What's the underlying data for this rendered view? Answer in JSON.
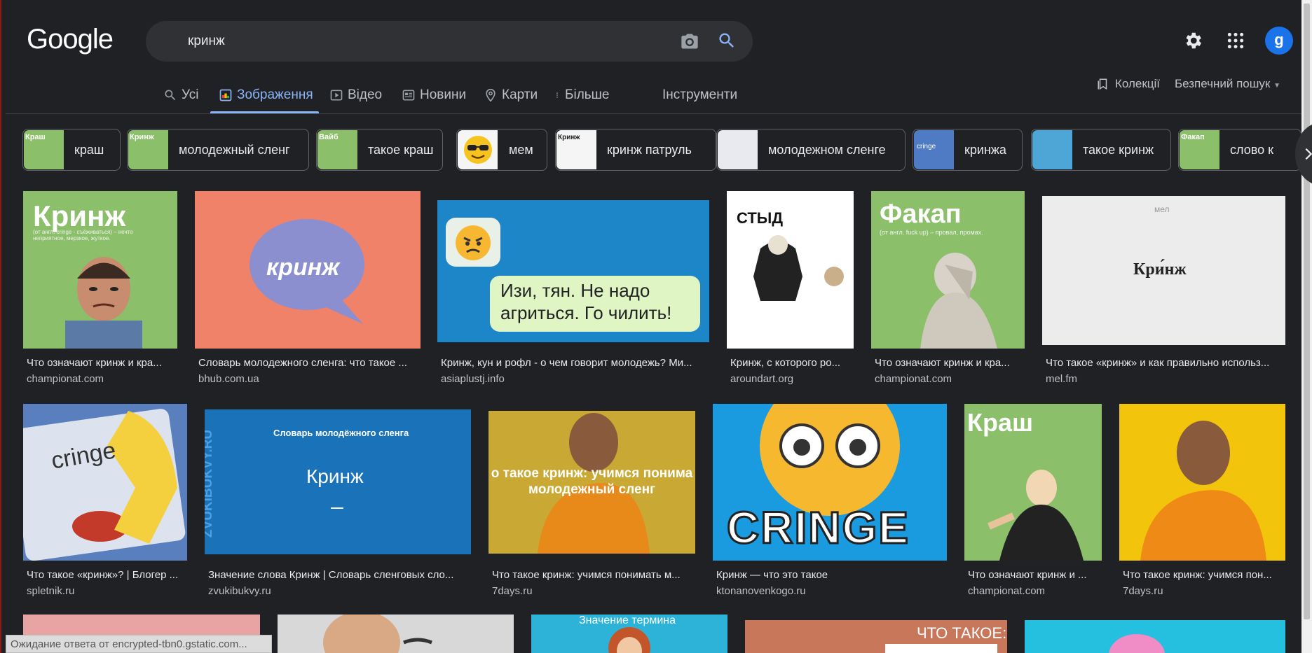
{
  "header": {
    "logo": "Google",
    "search_value": "кринж",
    "avatar_letter": "g"
  },
  "tabs": [
    {
      "label": "Усі",
      "icon": "search-icon"
    },
    {
      "label": "Зображення",
      "icon": "image-icon",
      "active": true
    },
    {
      "label": "Відео",
      "icon": "video-icon"
    },
    {
      "label": "Новини",
      "icon": "news-icon"
    },
    {
      "label": "Карти",
      "icon": "map-pin-icon"
    },
    {
      "label": "Більше",
      "icon": "more-vert-icon"
    },
    {
      "label": "Інструменти"
    }
  ],
  "right_links": {
    "collections": "Колекції",
    "safe_search": "Безпечний пошук"
  },
  "chips": [
    {
      "label": "краш",
      "thumb_text": "Краш",
      "thumb_color": "#8bbf6a"
    },
    {
      "label": "молодежный сленг",
      "thumb_text": "Кринж",
      "thumb_color": "#8bbf6a"
    },
    {
      "label": "такое краш",
      "thumb_text": "Вайб",
      "thumb_color": "#8bbf6a"
    },
    {
      "label": "мем",
      "thumb_text": "",
      "thumb_color": "#f5f5f5"
    },
    {
      "label": "кринж патруль",
      "thumb_text": "Кринж",
      "thumb_color": "#f5f5f5"
    },
    {
      "label": "молодежном сленге",
      "thumb_text": "",
      "thumb_color": "#e8eaf0"
    },
    {
      "label": "кринжа",
      "thumb_text": "cringe",
      "thumb_color": "#4f7bc4"
    },
    {
      "label": "такое кринж",
      "thumb_text": "",
      "thumb_color": "#4da6d6"
    },
    {
      "label": "слово к",
      "thumb_text": "Факап",
      "thumb_color": "#8bbf6a"
    }
  ],
  "results_row1": [
    {
      "caption": "Что означают кринж и кра...",
      "source": "championat.com",
      "title": "Кринж",
      "subtitle": "(от англ. cringe - съёживаться) – нечто неприятное, мерзкое, жуткое.",
      "bg": "#8bbf6a"
    },
    {
      "caption": "Словарь молодежного сленга: что такое ...",
      "source": "bhub.com.ua",
      "title": "кринж",
      "bg": "#f0826a"
    },
    {
      "caption": "Кринж, кун и рофл - о чем говорит молодежь? Ми...",
      "source": "asiaplustj.info",
      "title": "Изи, тян. Не надо агриться. Го чилить!",
      "bg": "#1c86c8"
    },
    {
      "caption": "Кринж, с которого ро...",
      "source": "aroundart.org",
      "title": "СТЫД",
      "bg": "#ffffff"
    },
    {
      "caption": "Что означают кринж и кра...",
      "source": "championat.com",
      "title": "Факап",
      "subtitle": "(от англ. fuck up) – провал, промах.",
      "bg": "#8bbf6a"
    },
    {
      "caption": "Что такое «кринж» и как правильно использ...",
      "source": "mel.fm",
      "title": "Кри́нж",
      "subtitle": "мел",
      "bg": "#ececec"
    }
  ],
  "results_row2": [
    {
      "caption": "Что такое «кринж»? | Блогер ...",
      "source": "spletnik.ru",
      "title": "cringe",
      "bg": "#5a7fbf"
    },
    {
      "caption": "Значение слова Кринж | Словарь сленговых сло...",
      "source": "zvukibukvy.ru",
      "title": "Кринж",
      "subtitle": "Словарь молодёжного сленга",
      "side": "ZVUKIBUKVY.RU",
      "bg": "#1a73b8"
    },
    {
      "caption": "Что такое кринж: учимся понимать м...",
      "source": "7days.ru",
      "title": "о такое кринж: учимся понима молодежный сленг",
      "bg": "#c9a833"
    },
    {
      "caption": "Кринж — что это такое",
      "source": "ktonanovenkogo.ru",
      "title": "CRINGE",
      "bg": "#1a9be0"
    },
    {
      "caption": "Что означают кринж и ...",
      "source": "championat.com",
      "title": "Краш",
      "bg": "#8bbf6a"
    },
    {
      "caption": "Что такое кринж: учимся пон...",
      "source": "7days.ru",
      "title": "",
      "bg": "#f2c50c"
    }
  ],
  "results_row3": [
    {
      "bg": "#e8a3a3",
      "title": ""
    },
    {
      "bg": "#d8d8d8",
      "title": ""
    },
    {
      "bg": "#2eb3d8",
      "title": "Значение термина"
    },
    {
      "bg": "#c9775a",
      "title": "ЧТО ТАКОЕ:"
    },
    {
      "bg": "#25c0e0",
      "title": ""
    }
  ],
  "status_bar": "Ожидание ответа от encrypted-tbn0.gstatic.com..."
}
